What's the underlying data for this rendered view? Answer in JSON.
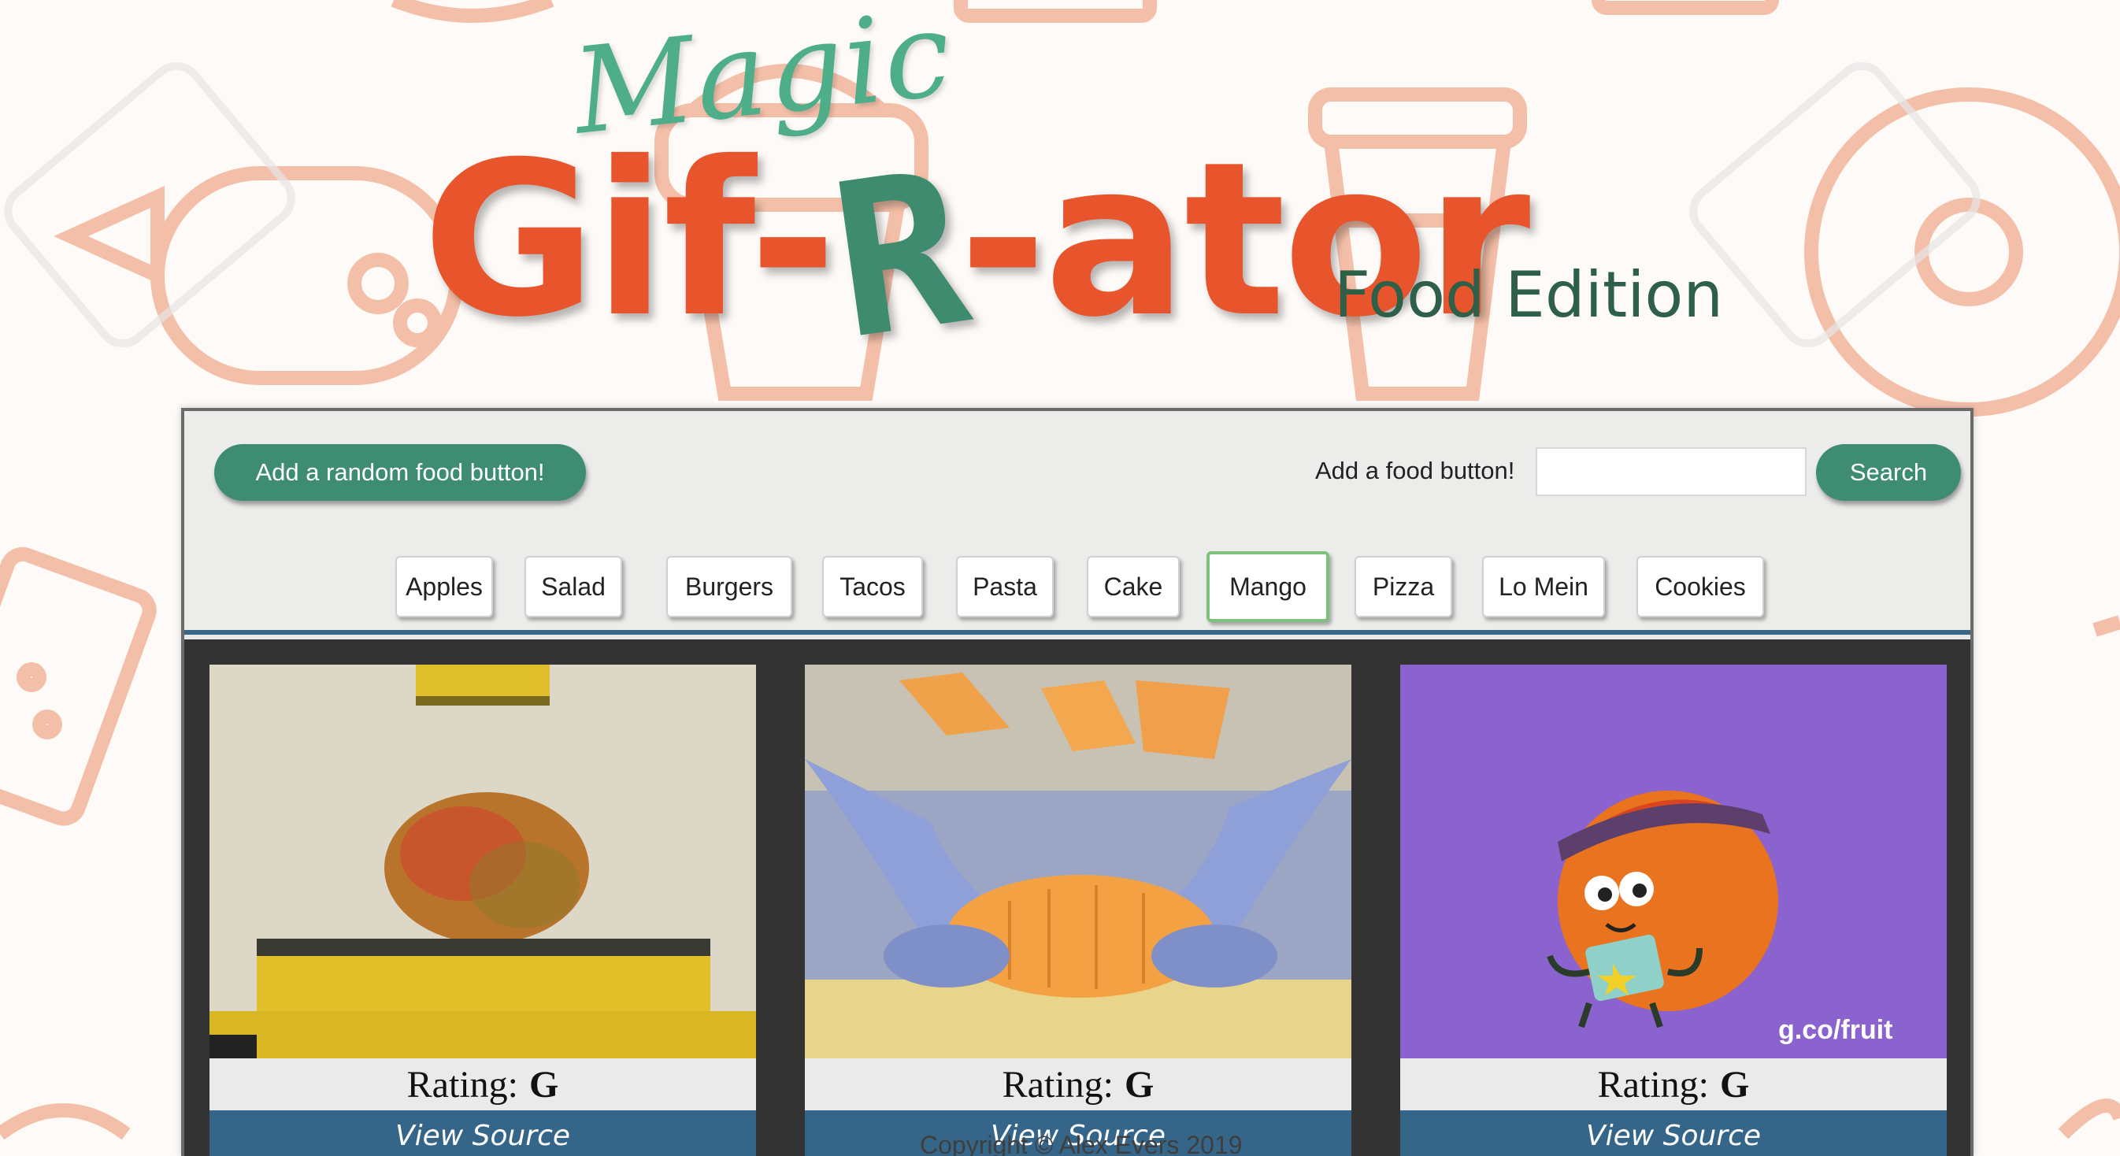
{
  "header": {
    "magic": "Magic",
    "title_before": "Gif-",
    "title_r": "R",
    "title_after": "-ator",
    "edition": "Food Edition"
  },
  "controls": {
    "random_button": "Add a random food button!",
    "add_label": "Add a food button!",
    "input_value": "",
    "search_button": "Search"
  },
  "food_buttons": [
    {
      "label": "Apples",
      "active": false
    },
    {
      "label": "Salad",
      "active": false
    },
    {
      "label": "Burgers",
      "active": false
    },
    {
      "label": "Tacos",
      "active": false
    },
    {
      "label": "Pasta",
      "active": false
    },
    {
      "label": "Cake",
      "active": false
    },
    {
      "label": "Mango",
      "active": true
    },
    {
      "label": "Pizza",
      "active": false
    },
    {
      "label": "Lo Mein",
      "active": false
    },
    {
      "label": "Cookies",
      "active": false
    }
  ],
  "gifs": [
    {
      "rating_label": "Rating:",
      "rating": "G",
      "source_label": "View Source",
      "image": "mango-on-hydraulic-press"
    },
    {
      "rating_label": "Rating:",
      "rating": "G",
      "source_label": "View Source",
      "image": "hands-cutting-mango"
    },
    {
      "rating_label": "Rating:",
      "rating": "G",
      "source_label": "View Source",
      "image": "cartoon-mango-character",
      "watermark": "g.co/fruit"
    }
  ],
  "footer": {
    "copyright": "Copyright © Alex Evers 2019"
  },
  "colors": {
    "brand_green": "#3e8d73",
    "title_orange": "#e8552c",
    "source_blue": "#356689",
    "active_border": "#7cc27a"
  }
}
